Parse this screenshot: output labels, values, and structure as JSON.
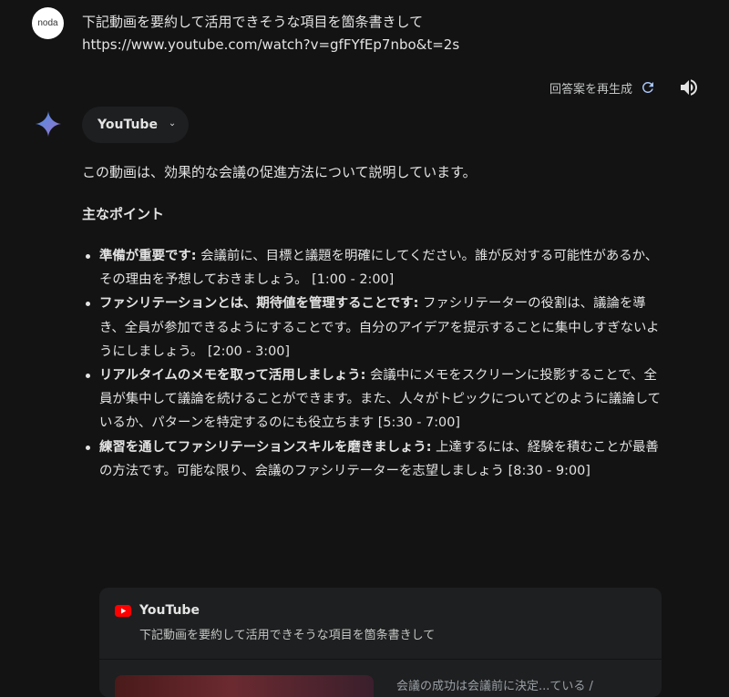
{
  "user": {
    "avatar_label": "noda",
    "prompt_line1": "下記動画を要約して活用できそうな項目を箇条書きして",
    "prompt_line2": "https://www.youtube.com/watch?v=gfFYfEp7nbo&t=2s"
  },
  "toolbar": {
    "regenerate_label": "回答案を再生成"
  },
  "source_chip": {
    "label": "YouTube"
  },
  "response": {
    "intro": "この動画は、効果的な会議の促進方法について説明しています。",
    "heading": "主なポイント",
    "bullets": [
      {
        "title": "準備が重要です:",
        "text": " 会議前に、目標と議題を明確にしてください。誰が反対する可能性があるか、その理由を予想しておきましょう。 [1:00 - 2:00]"
      },
      {
        "title": "ファシリテーションとは、期待値を管理することです:",
        "text": " ファシリテーターの役割は、議論を導き、全員が参加できるようにすることです。自分のアイデアを提示することに集中しすぎないようにしましょう。 [2:00 - 3:00]"
      },
      {
        "title": "リアルタイムのメモを取って活用しましょう:",
        "text": " 会議中にメモをスクリーンに投影することで、全員が集中して議論を続けることができます。また、人々がトピックについてどのように議論しているか、パターンを特定するのにも役立ちます [5:30 - 7:00]"
      },
      {
        "title": "練習を通してファシリテーションスキルを磨きましょう:",
        "text": " 上達するには、経験を積むことが最善の方法です。可能な限り、会議のファシリテーターを志望しましょう [8:30 - 9:00]"
      }
    ]
  },
  "extension_card": {
    "title": "YouTube",
    "subtitle": "下記動画を要約して活用できそうな項目を箇条書きして",
    "partial_text": "会議の成功は会議前に決定...ている /"
  },
  "colors": {
    "background": "#131314",
    "surface": "#1e1f20",
    "text": "#e3e3e3",
    "youtube_red": "#ff0000",
    "regen_icon": "#a8c7fa"
  }
}
